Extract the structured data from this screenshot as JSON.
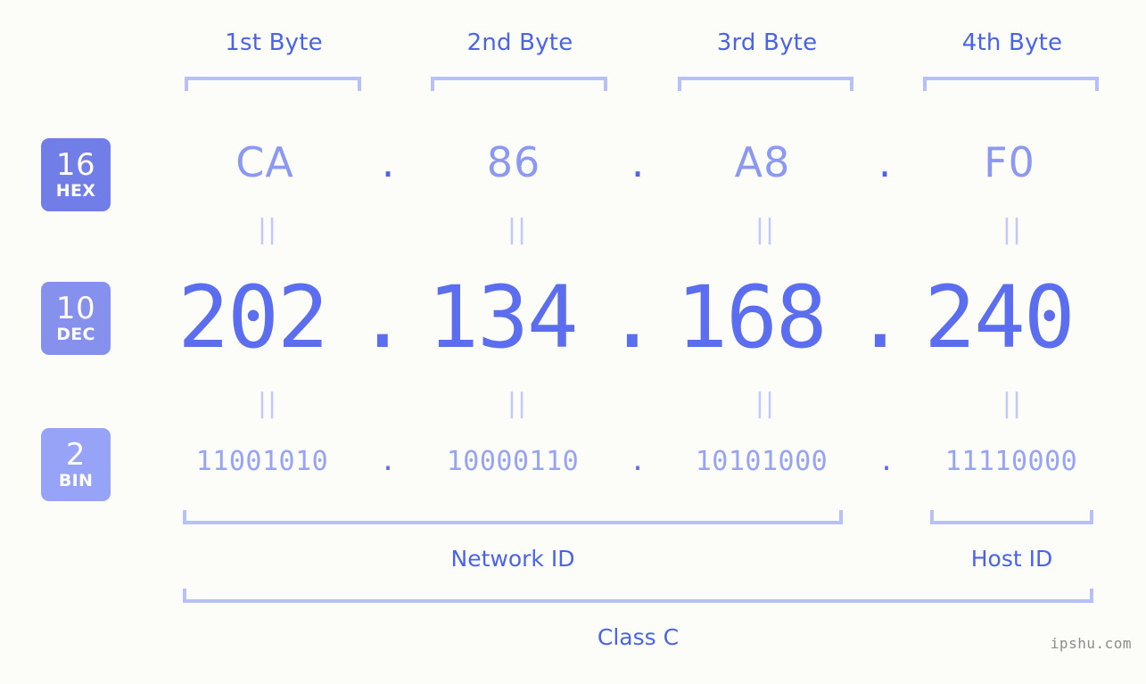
{
  "watermark": "ipshu.com",
  "header": {
    "byte_labels": [
      "1st Byte",
      "2nd Byte",
      "3rd Byte",
      "4th Byte"
    ]
  },
  "bases": [
    {
      "number": "16",
      "name": "HEX",
      "color": "#717ee8"
    },
    {
      "number": "10",
      "name": "DEC",
      "color": "#8691ee"
    },
    {
      "number": "2",
      "name": "BIN",
      "color": "#96a3f6"
    }
  ],
  "separator": ".",
  "equals_mark": "||",
  "rows": {
    "hex": {
      "label": "HEX",
      "base": "16",
      "octets": [
        "CA",
        "86",
        "A8",
        "F0"
      ]
    },
    "dec": {
      "label": "DEC",
      "base": "10",
      "octets": [
        "202",
        "134",
        "168",
        "240"
      ]
    },
    "bin": {
      "label": "BIN",
      "base": "2",
      "octets": [
        "11001010",
        "10000110",
        "10101000",
        "11110000"
      ]
    }
  },
  "ip_address": {
    "hex": "CA.86.A8.F0",
    "dec": "202.134.168.240",
    "bin": "11001010.10000110.10101000.11110000"
  },
  "sections": {
    "network_id": "Network ID",
    "host_id": "Host ID",
    "class": "Class C"
  },
  "colors": {
    "background": "#fcfdf8",
    "accent_strong": "#4a63e7",
    "accent_dec": "#5c6ef0",
    "accent_light": "#97a3f4",
    "bracket": "#b8c0fb",
    "equals": "#c3c9fc",
    "watermark": "#8c8c8c"
  }
}
